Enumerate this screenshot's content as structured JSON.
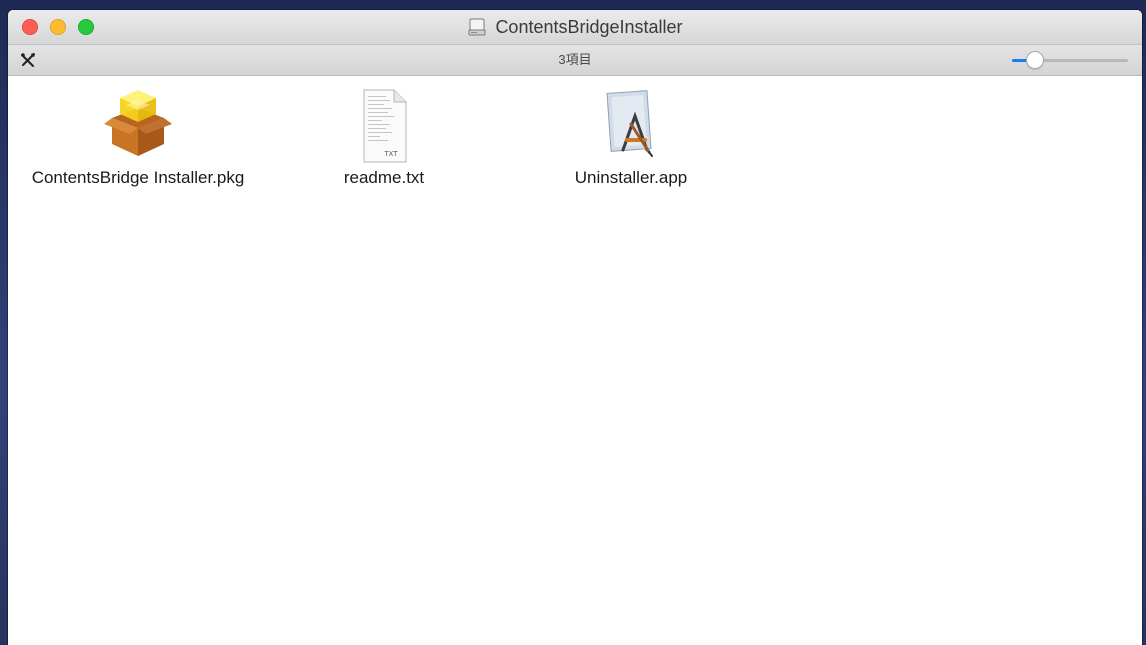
{
  "window": {
    "title": "ContentsBridgeInstaller",
    "status_text": "3項目",
    "icon_size_slider": {
      "value_fraction": 0.17
    }
  },
  "files": [
    {
      "name": "ContentsBridge Installer.pkg",
      "icon": "package-icon"
    },
    {
      "name": "readme.txt",
      "icon": "text-file-icon",
      "badge": "TXT"
    },
    {
      "name": "Uninstaller.app",
      "icon": "app-icon"
    }
  ],
  "colors": {
    "close": "#fd5f57",
    "minimize": "#febc2e",
    "maximize": "#28c840",
    "slider_accent": "#1a7cf5"
  }
}
